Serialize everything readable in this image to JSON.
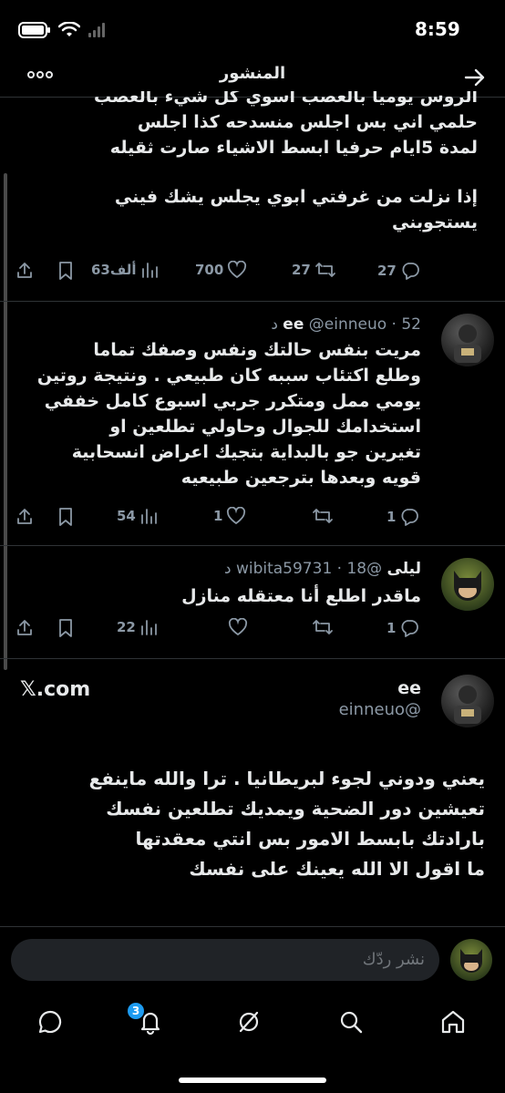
{
  "status_bar": {
    "time": "8:59"
  },
  "header": {
    "title": "المنشور"
  },
  "main_tweet": {
    "cut_line": "الروس يوميا بالعصب اسوي كل شيء بالعصب",
    "lines": [
      "حلمي اني بس اجلس منسدحه كذا اجلس",
      "لمدة 5ايام حرفيا ابسط الاشياء صارت ثقيله"
    ],
    "para2_lines": [
      "إذا نزلت من غرفتي ابوي يجلس يشك فيني",
      "يستجوبني"
    ],
    "stats": {
      "replies": "27",
      "reposts": "27",
      "likes": "700",
      "views": "63ألف"
    }
  },
  "replies": [
    {
      "name": "ee",
      "handle": "@einneuo",
      "time": "52 د",
      "lines": [
        "مريت بنفس حالتك ونفس وصفك تماما",
        "وطلع اكتئاب سببه كان طبيعي . ونتيجة روتين",
        "يومي ممل ومتكرر جربي اسبوع كامل خففي",
        "استخدامك للجوال وحاولي تطلعين او",
        "تغيرين جو بالبداية بتجيك اعراض انسحابية",
        "قويه وبعدها بترجعين طبيعيه"
      ],
      "stats": {
        "replies": "1",
        "reposts": "",
        "likes": "1",
        "views": "54"
      }
    },
    {
      "name": "ليلى",
      "handle": "@wibita59731",
      "time": "18 د",
      "lines": [
        "ماقدر اطلع أنا معتقله منازل"
      ],
      "stats": {
        "replies": "1",
        "reposts": "",
        "likes": "",
        "views": "22"
      }
    }
  ],
  "focused_reply": {
    "name": "ee",
    "handle": "@einneuo",
    "source": "𝕏.com",
    "lines": [
      "يعني ودوني لجوء لبريطانيا . ترا والله ماينفع",
      "تعيشين دور الضحية ويمديك تطلعين نفسك",
      "بارادتك بابسط الامور بس انتي معقدتها",
      "ما اقول الا الله يعينك على نفسك"
    ]
  },
  "reply_box": {
    "placeholder": "نشر ردّك"
  },
  "tabbar": {
    "notifications_badge": "3"
  },
  "colors": {
    "accent": "#1d9bf0",
    "background": "#000000",
    "muted": "#8b98a5"
  }
}
